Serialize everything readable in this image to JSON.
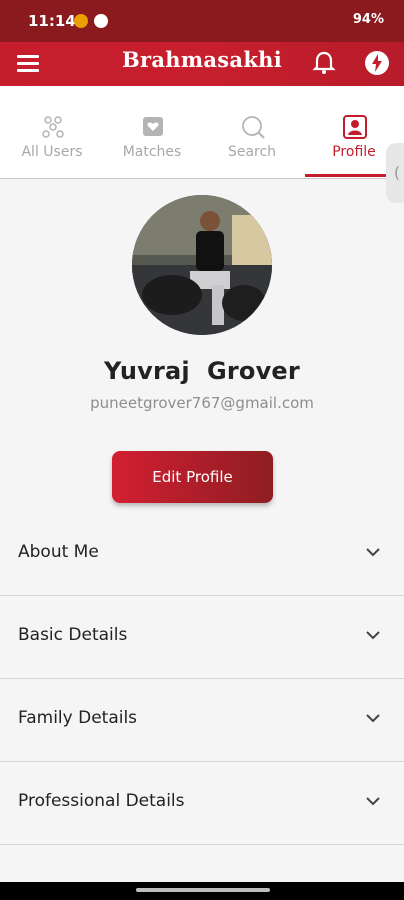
{
  "status_bar": {
    "time": "11:14",
    "right_text": "94%",
    "background": "#8b1a1f"
  },
  "header": {
    "brand": "Brahmasakhi",
    "accent": "#c51d2c"
  },
  "tabs": [
    {
      "label": "All Users",
      "icon": "users-icon",
      "active": false
    },
    {
      "label": "Matches",
      "icon": "heart-badge-icon",
      "active": false
    },
    {
      "label": "Search",
      "icon": "search-icon",
      "active": false
    },
    {
      "label": "Profile",
      "icon": "profile-icon",
      "active": true
    }
  ],
  "profile": {
    "name": "Yuvraj  Grover",
    "email": "puneetgrover767@gmail.com",
    "edit_label": "Edit Profile"
  },
  "sections": [
    {
      "label": "About Me"
    },
    {
      "label": "Basic Details"
    },
    {
      "label": "Family Details"
    },
    {
      "label": "Professional Details"
    }
  ]
}
